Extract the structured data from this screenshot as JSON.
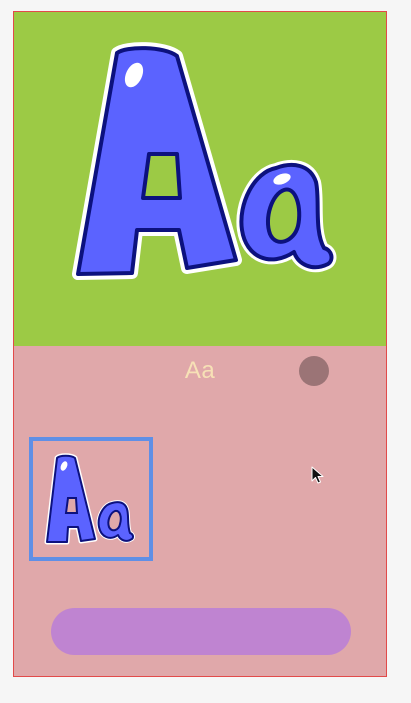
{
  "app": {
    "title": "Aa"
  },
  "hero": {
    "icon": "letters-aa-icon"
  },
  "thumbnail": {
    "icon": "letters-aa-icon"
  },
  "indicator": {
    "icon": "record-dot-icon"
  },
  "primary_button": {
    "label": ""
  },
  "colors": {
    "hero_bg": "#9cca45",
    "panel_bg": "#e0a8aa",
    "letter_fill": "#5b63ff",
    "letter_outline": "#0c117e",
    "title_text": "#f7e1b6",
    "thumb_border": "#5f8fe6",
    "button_bg": "#bf84d1",
    "dot": "#9b7476"
  }
}
